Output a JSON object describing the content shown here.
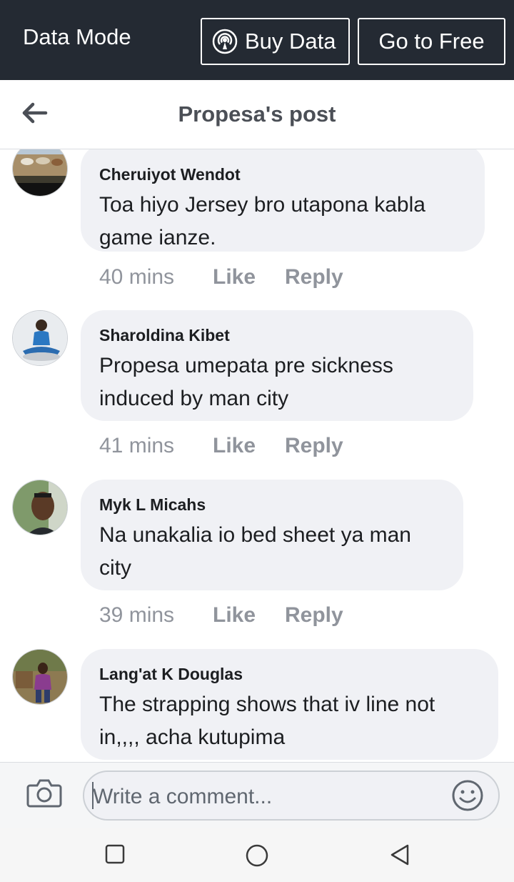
{
  "databar": {
    "mode_label": "Data Mode",
    "buy_label": "Buy Data",
    "free_label": "Go to Free"
  },
  "header": {
    "title": "Propesa's post"
  },
  "comments": [
    {
      "author": "Cheruiyot Wendot",
      "text": "Toa hiyo Jersey bro utapona kabla game ianze.",
      "time": "40 mins",
      "like": "Like",
      "reply": "Reply"
    },
    {
      "author": "Sharoldina Kibet",
      "text": "Propesa umepata   pre sickness induced by man city",
      "time": "41 mins",
      "like": "Like",
      "reply": "Reply"
    },
    {
      "author": "Myk L Micahs",
      "text": "Na unakalia io bed sheet ya man city",
      "time": "39 mins",
      "like": "Like",
      "reply": "Reply"
    },
    {
      "author": "Lang'at K Douglas",
      "text": "The strapping shows that iv line not in,,,, acha kutupima",
      "time": "",
      "like": "",
      "reply": ""
    }
  ],
  "composer": {
    "placeholder": "Write a comment..."
  },
  "colors": {
    "topbar": "#242a33",
    "bubble": "#f0f1f5",
    "meta": "#90949c"
  }
}
